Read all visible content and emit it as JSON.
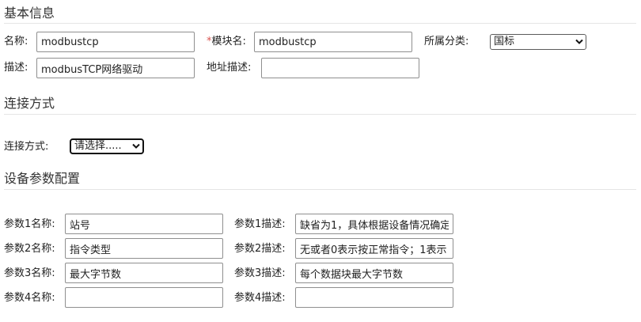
{
  "sections": {
    "basic": "基本信息",
    "connection": "连接方式",
    "params": "设备参数配置"
  },
  "basic": {
    "name_label": "名称:",
    "name_value": "modbustcp",
    "module_label_star": "*",
    "module_label": "模块名:",
    "module_value": "modbustcp",
    "category_label": "所属分类:",
    "category_value": "国标",
    "desc_label": "描述:",
    "desc_value": "modbusTCP网络驱动",
    "addr_desc_label": "地址描述:",
    "addr_desc_value": ""
  },
  "connection": {
    "label": "连接方式:",
    "select_value": "请选择....."
  },
  "params": [
    {
      "name_label": "参数1名称:",
      "name_value": "站号",
      "desc_label": "参数1描述:",
      "desc_value": "缺省为1，具体根据设备情况确定"
    },
    {
      "name_label": "参数2名称:",
      "name_value": "指令类型",
      "desc_label": "参数2描述:",
      "desc_value": "无或者0表示按正常指令；1表示"
    },
    {
      "name_label": "参数3名称:",
      "name_value": "最大字节数",
      "desc_label": "参数3描述:",
      "desc_value": "每个数据块最大字节数"
    },
    {
      "name_label": "参数4名称:",
      "name_value": "",
      "desc_label": "参数4描述:",
      "desc_value": ""
    }
  ],
  "icons": {
    "dropdown": "chevron-down-icon"
  }
}
